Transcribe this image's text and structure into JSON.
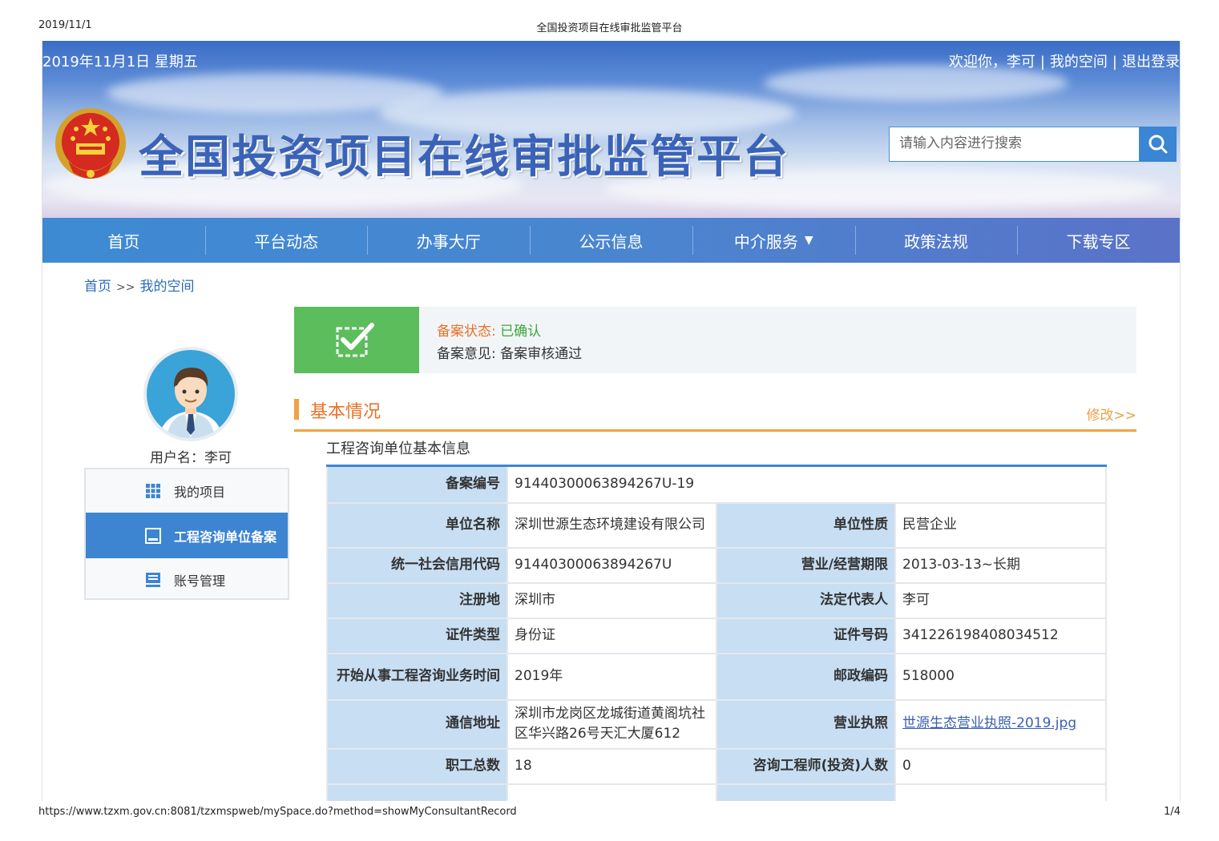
{
  "print": {
    "date": "2019/11/1",
    "title": "全国投资项目在线审批监管平台",
    "url": "https://www.tzxm.gov.cn:8081/tzxmspweb/mySpace.do?method=showMyConsultantRecord",
    "page": "1/4"
  },
  "header": {
    "date": "2019年11月1日 星期五",
    "welcome": "欢迎你，李可",
    "my_space": "我的空间",
    "logout": "退出登录",
    "sep": "|",
    "site_title": "全国投资项目在线审批监管平台",
    "search_placeholder": "请输入内容进行搜索"
  },
  "nav": {
    "items": [
      "首页",
      "平台动态",
      "办事大厅",
      "公示信息",
      "中介服务",
      "政策法规",
      "下载专区"
    ],
    "dropdown_caret": "▼"
  },
  "breadcrumb": {
    "home": "首页",
    "arrow": ">>",
    "current": "我的空间"
  },
  "user": {
    "username_label": "用户名：李可"
  },
  "sidebar": {
    "items": [
      {
        "label": "我的项目",
        "icon": "grid-icon"
      },
      {
        "label": "工程咨询单位备案",
        "icon": "square-icon"
      },
      {
        "label": "账号管理",
        "icon": "monitor-icon"
      }
    ]
  },
  "status": {
    "state_label": "备案状态:",
    "state_value": "已确认",
    "opinion_label": "备案意见:",
    "opinion_value": "备案审核通过",
    "colors": {
      "accent_green": "#5cbd5c",
      "label_orange": "#e8722a"
    }
  },
  "section": {
    "title": "基本情况",
    "edit": "修改>>",
    "subtitle": "工程咨询单位基本信息"
  },
  "table": {
    "filing_no_label": "备案编号",
    "filing_no": "91440300063894267U-19",
    "rows": [
      {
        "l1": "单位名称",
        "v1": "深圳世源生态环境建设有限公司",
        "l2": "单位性质",
        "v2": "民营企业"
      },
      {
        "l1": "统一社会信用代码",
        "v1": "91440300063894267U",
        "l2": "营业/经营期限",
        "v2": "2013-03-13~长期"
      },
      {
        "l1": "注册地",
        "v1": "深圳市",
        "l2": "法定代表人",
        "v2": "李可"
      },
      {
        "l1": "证件类型",
        "v1": "身份证",
        "l2": "证件号码",
        "v2": "341226198408034512"
      },
      {
        "l1": "开始从事工程咨询业务时间",
        "v1": "2019年",
        "l2": "邮政编码",
        "v2": "518000"
      },
      {
        "l1": "通信地址",
        "v1": "深圳市龙岗区龙城街道黄阁坑社区华兴路26号天汇大厦612",
        "l2": "营业执照",
        "v2": "世源生态营业执照-2019.jpg"
      },
      {
        "l1": "职工总数",
        "v1": "18",
        "l2": "咨询工程师(投资)人数",
        "v2": "0"
      }
    ]
  }
}
